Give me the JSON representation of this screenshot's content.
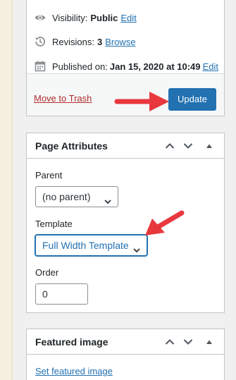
{
  "publish": {
    "visibility_label": "Visibility:",
    "visibility_value": "Public",
    "visibility_edit": "Edit",
    "revisions_label": "Revisions:",
    "revisions_count": "3",
    "revisions_browse": "Browse",
    "published_label": "Published on:",
    "published_date": "Jan 15, 2020 at 10:49",
    "published_edit": "Edit",
    "trash_label": "Move to Trash",
    "update_label": "Update"
  },
  "page_attributes": {
    "title": "Page Attributes",
    "parent_label": "Parent",
    "parent_value": "(no parent)",
    "template_label": "Template",
    "template_value": "Full Width Template",
    "order_label": "Order",
    "order_value": "0"
  },
  "featured_image": {
    "title": "Featured image",
    "set_link": "Set featured image"
  },
  "colors": {
    "accent": "#2271b1",
    "danger": "#b32d2e",
    "annotation_arrow": "#e8383d"
  },
  "icons": [
    "eye-icon",
    "history-icon",
    "calendar-icon",
    "chevron-up-icon",
    "chevron-down-icon",
    "toggle-arrow-icon",
    "select-chevron-icon"
  ]
}
